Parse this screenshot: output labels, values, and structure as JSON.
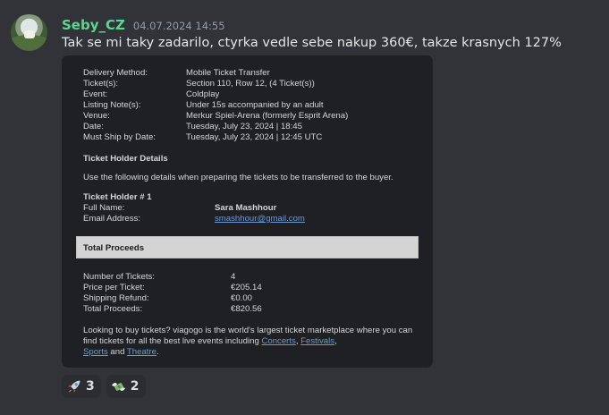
{
  "message": {
    "username": "Seby_CZ",
    "timestamp": "04.07.2024 14:55",
    "text": "Tak se mi taky zadarilo, ctyrka vedle sebe nakup 360€, takze krasnych 127%"
  },
  "ticket": {
    "details": [
      {
        "label": "Delivery Method:",
        "value": "Mobile Ticket Transfer"
      },
      {
        "label": "Ticket(s):",
        "value": "Section 110, Row 12, (4 Ticket(s))"
      },
      {
        "label": "Event:",
        "value": "Coldplay"
      },
      {
        "label": "Listing Note(s):",
        "value": "Under 15s accompanied by an adult"
      },
      {
        "label": "Venue:",
        "value": "Merkur Spiel-Arena (formerly Esprit Arena)"
      },
      {
        "label": "Date:",
        "value": "Tuesday, July 23, 2024 | 18:45"
      },
      {
        "label": "Must Ship by Date:",
        "value": "Tuesday, July 23, 2024 | 12:45 UTC"
      }
    ],
    "holder_section_title": "Ticket Holder Details",
    "holder_intro": "Use the following details when preparing the tickets to be transferred to the buyer.",
    "holder_title": "Ticket Holder # 1",
    "holder": [
      {
        "label": "Full Name:",
        "value": "Sara Mashhour"
      },
      {
        "label": "Email Address:",
        "value": "smashhour@gmail.com"
      }
    ],
    "proceeds_title": "Total Proceeds",
    "proceeds": [
      {
        "label": "Number of Tickets:",
        "value": "4"
      },
      {
        "label": "Price per Ticket:",
        "value": "€205.14"
      },
      {
        "label": "Shipping Refund:",
        "value": "€0.00"
      },
      {
        "label": "Total Proceeds:",
        "value": "€820.56"
      }
    ],
    "footer": {
      "text_a": "Looking to buy tickets? viagogo is the world's largest ticket marketplace where you can find tickets for all the best live events including ",
      "link_concerts": "Concerts",
      "comma1": ", ",
      "link_festivals": "Festivals",
      "comma2": ",",
      "link_sports": "Sports",
      "and": " and ",
      "link_theatre": "Theatre",
      "end": "."
    }
  },
  "reactions": [
    {
      "icon": "rocket-icon",
      "count": "3"
    },
    {
      "icon": "money-with-wings-icon",
      "count": "2"
    }
  ]
}
